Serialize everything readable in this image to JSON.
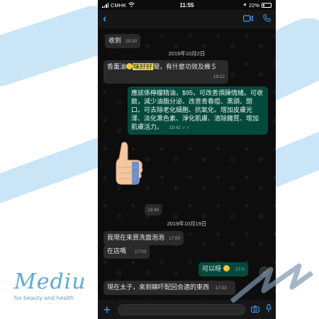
{
  "status": {
    "carrier": "CMHK",
    "time": "11:55",
    "battery": "22%"
  },
  "nav": {
    "back_icon": "chevron-left-icon",
    "video_icon": "video-call-icon",
    "phone_icon": "phone-icon"
  },
  "messages": {
    "m1": {
      "text": "收到",
      "time": "20:30"
    },
    "date1": "2019年10月2日",
    "m2": {
      "text_before": "香薰油",
      "text_highlight": "味好好",
      "text_after": "聞，有什麼功效及幾＄",
      "time": "19:22"
    },
    "m3": {
      "text": "應該係檸檬精油，$95，可改善煩躁情緒。可收斂，減少油脂分泌、改善青春痘、黑頭、閉口。可去除老化細胞、抗氧化、增加皮膚光澤、淡化黑色素、淨化肌膚、清除雜質、增加肌膚活力。",
      "time": "19:42"
    },
    "m4": {
      "time": "19:48"
    },
    "date2": "2019年10月19日",
    "m5": {
      "text": "我現在來買洗面泡泡",
      "time": "17:00"
    },
    "m6": {
      "text": "在店嗎",
      "time": "17:00"
    },
    "m7": {
      "text": "可以呀",
      "time": "17:0"
    },
    "m8": {
      "text": "現在太子，來到睇吓配回合適的東西",
      "time": "17:03"
    }
  },
  "logo": {
    "word": "Mediu",
    "tagline": "for beauty and health"
  },
  "colors": {
    "accent": "#3a9df5",
    "outgoing": "#044a3c",
    "incoming": "#2a2a2a",
    "brand": "#5fa8d8"
  }
}
